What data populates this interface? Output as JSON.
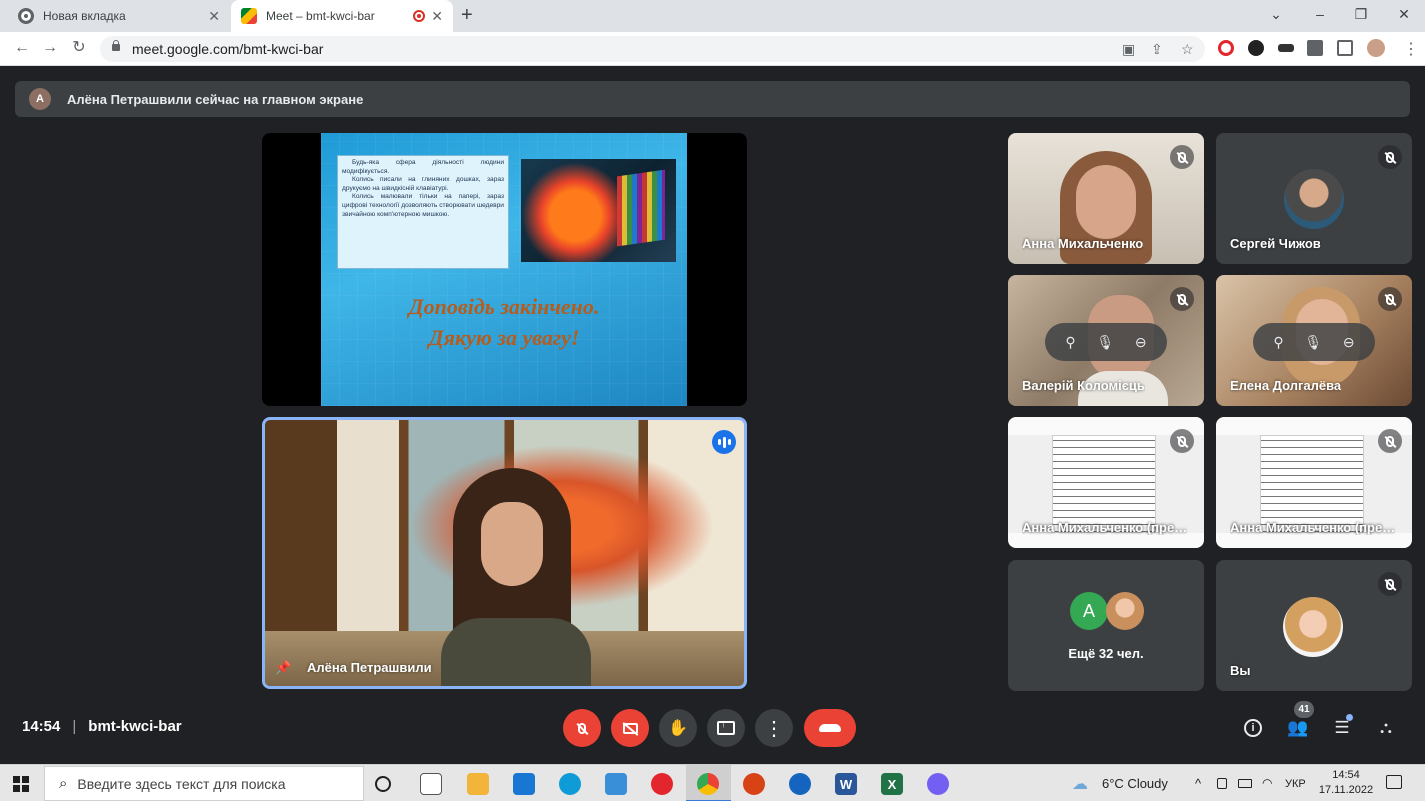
{
  "browser": {
    "tabs": [
      {
        "title": "Новая вкладка",
        "active": false
      },
      {
        "title": "Meet – bmt-kwci-bar",
        "active": true,
        "recording": true
      }
    ],
    "new_tab": "+",
    "window_controls": {
      "minimize": "–",
      "maximize": "❐",
      "close": "✕",
      "tab_search": "⌄"
    },
    "nav": {
      "back": "←",
      "forward": "→",
      "reload": "↻"
    },
    "url": "meet.google.com/bmt-kwci-bar",
    "omnibox_icons": [
      "camera-icon",
      "share-icon",
      "bookmark-star-icon"
    ],
    "extensions": [
      "opera-icon",
      "extension-w-icon",
      "incognito-mask-icon",
      "puzzle-extensions-icon",
      "sidebar-icon",
      "profile-avatar",
      "menu-kebab-icon"
    ]
  },
  "banner": {
    "avatar_letter": "A",
    "text": "Алёна Петрашвили сейчас на главном экране"
  },
  "presentation": {
    "paragraphs": [
      "Будь-яка сфера діяльності людини модифікується.",
      "Колись писали на глиняних дошках, зараз друкуємо на швидкісній клавіатурі.",
      "Колись малювали тільки на папері, зараз цифрові технології дозволяють створювати шедеври звичайною комп'ютерною мишкою."
    ],
    "title_line1": "Доповідь закінчено.",
    "title_line2": "Дякую за увагу!"
  },
  "speaker": {
    "name": "Алёна Петрашвили",
    "pin_icon": "📌"
  },
  "participants": [
    {
      "name": "Анна Михальченко",
      "muted": true
    },
    {
      "name": "Сергей Чижов",
      "muted": true
    },
    {
      "name": "Валерій Коломієць",
      "muted": true
    },
    {
      "name": "Елена Долгалёва",
      "muted": true
    },
    {
      "name": "Анна Михальченко (пре…",
      "muted": true
    },
    {
      "name": "Анна Михальченко (пре…",
      "muted": true
    },
    {
      "name": "Вы",
      "muted": true
    }
  ],
  "tile_hover_icons": {
    "pin": "⚲",
    "mute": "🎙",
    "remove": "⊖"
  },
  "more": {
    "avatar_letter": "A",
    "label": "Ещё 32 чел."
  },
  "bottom": {
    "time": "14:54",
    "separator": "|",
    "meeting_code": "bmt-kwci-bar",
    "people_count": "41",
    "hand_icon": "✋",
    "more_icon": "⋮",
    "info_icon": "i",
    "people_icon": "👥",
    "chat_icon": "☰",
    "activities_icon": "⛬"
  },
  "taskbar": {
    "search_placeholder": "Введите здесь текст для поиска",
    "search_icon": "⌕",
    "weather": "6°C  Cloudy",
    "language": "УКР",
    "clock_time": "14:54",
    "clock_date": "17.11.2022",
    "tray_chevron": "^"
  },
  "colors": {
    "meet_bg": "#202124",
    "tile_bg": "#3c4043",
    "danger": "#ea4335",
    "active_speaker_border": "#8ab4f8",
    "slide_title": "#b65c1c"
  }
}
